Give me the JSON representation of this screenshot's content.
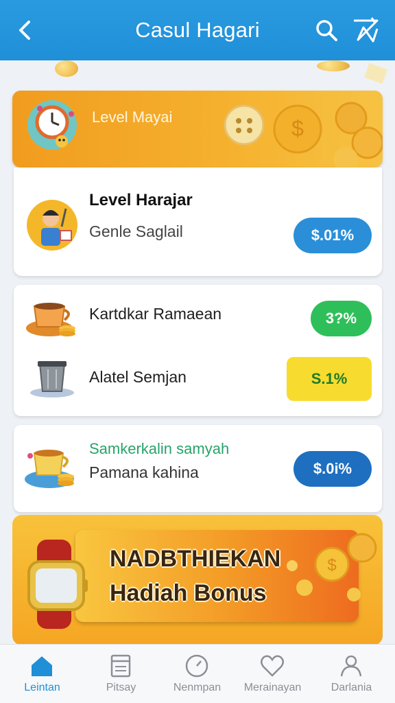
{
  "header": {
    "title": "Casul Hagari",
    "back_icon": "chevron-left-icon",
    "search_icon": "search-icon",
    "extra_icon": "star-burst-icon"
  },
  "level_banner": {
    "label": "Level Mayai"
  },
  "card1": {
    "title": "Level Harajar",
    "subtitle": "Genle Saglail",
    "pill": "$.01%"
  },
  "card2": {
    "row1": {
      "label": "Kartdkar Ramaean",
      "pill": "3?%"
    },
    "row2": {
      "label": "Alatel Semjan",
      "pill": "S.1%"
    }
  },
  "card3": {
    "title": "Samkerkalin samyah",
    "subtitle": "Pamana kahina",
    "pill": "$.0i%"
  },
  "bonus": {
    "title": "NADBTHIEKAN",
    "subtitle": "Hadiah Bonus"
  },
  "bottom_nav": {
    "items": [
      {
        "label": "Leintan",
        "icon": "home-icon",
        "active": true
      },
      {
        "label": "Pitsay",
        "icon": "list-icon",
        "active": false
      },
      {
        "label": "Nenmpan",
        "icon": "clock-icon",
        "active": false
      },
      {
        "label": "Merainayan",
        "icon": "heart-icon",
        "active": false
      },
      {
        "label": "Darlania",
        "icon": "user-icon",
        "active": false
      }
    ]
  },
  "colors": {
    "header_blue": "#1f8fd8",
    "pill_blue": "#2a8fd8",
    "pill_green": "#2fbf5a",
    "pill_yellow": "#f7dc2f",
    "pill_dark_blue": "#1e6fc0",
    "banner_orange": "#f19c1f"
  }
}
